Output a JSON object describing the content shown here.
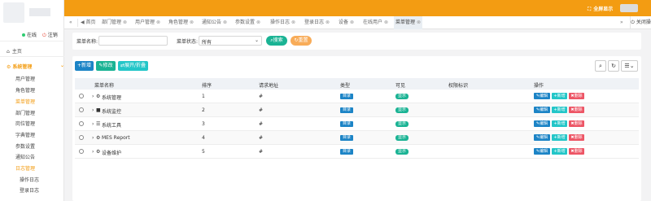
{
  "topbar": {
    "fullscreen_label": "全屏显示",
    "fullscreen_icon": "expand-icon",
    "color": "#f39c12"
  },
  "sidebar": {
    "status_online": "在线",
    "logout": "注销",
    "home": "主页",
    "group": "系统管理",
    "items": [
      {
        "label": "用户管理"
      },
      {
        "label": "角色管理"
      },
      {
        "label": "菜单管理",
        "active": true
      },
      {
        "label": "部门管理"
      },
      {
        "label": "岗位管理"
      },
      {
        "label": "字典管理"
      },
      {
        "label": "参数设置"
      },
      {
        "label": "通知公告"
      },
      {
        "label": "日志管理",
        "active": true
      },
      {
        "label": "操作日志",
        "sub": true
      },
      {
        "label": "登录日志",
        "sub": true
      }
    ]
  },
  "tabs": {
    "items": [
      {
        "label": "首页"
      },
      {
        "label": "部门管理"
      },
      {
        "label": "用户管理"
      },
      {
        "label": "角色管理"
      },
      {
        "label": "通知公告"
      },
      {
        "label": "参数设置"
      },
      {
        "label": "操作日志"
      },
      {
        "label": "登录日志"
      },
      {
        "label": "设备"
      },
      {
        "label": "在线用户"
      },
      {
        "label": "菜单管理",
        "active": true
      }
    ],
    "close_label": "关闭操作"
  },
  "search": {
    "name_label": "菜单名称:",
    "name_value": "",
    "status_label": "菜单状态:",
    "status_value": "所有",
    "search_btn": "搜索",
    "reset_btn": "重置"
  },
  "toolbar": {
    "add": "新增",
    "edit": "修改",
    "expand": "展开/折叠"
  },
  "table": {
    "headers": [
      "菜单名称",
      "排序",
      "请求地址",
      "类型",
      "可见",
      "权限标识",
      "操作"
    ],
    "rows": [
      {
        "name": "系统管理",
        "icon": "gear-icon",
        "order": "1",
        "url": "#",
        "type": "目录",
        "visible": "显示",
        "perm": ""
      },
      {
        "name": "系统监控",
        "icon": "video-camera-icon",
        "order": "2",
        "url": "#",
        "type": "目录",
        "visible": "显示",
        "perm": ""
      },
      {
        "name": "系统工具",
        "icon": "bars-icon",
        "order": "3",
        "url": "#",
        "type": "目录",
        "visible": "显示",
        "perm": ""
      },
      {
        "name": "MES Report",
        "icon": "cogs-icon",
        "order": "4",
        "url": "#",
        "type": "目录",
        "visible": "显示",
        "perm": ""
      },
      {
        "name": "设备维护",
        "icon": "cogs-icon",
        "order": "5",
        "url": "#",
        "type": "目录",
        "visible": "显示",
        "perm": ""
      }
    ],
    "actions": {
      "edit": "编辑",
      "add": "新增",
      "delete": "删除"
    }
  }
}
